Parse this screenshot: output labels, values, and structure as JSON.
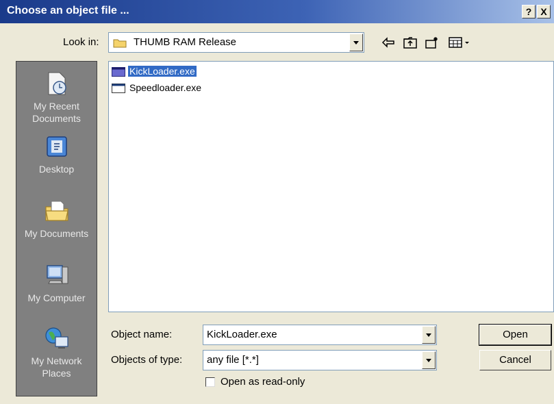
{
  "window": {
    "title": "Choose an object file ...",
    "help_label": "?",
    "close_label": "X"
  },
  "lookin": {
    "label": "Look in:",
    "value": "THUMB RAM Release"
  },
  "toolbar": {
    "icons": [
      "back-arrow-icon",
      "up-folder-icon",
      "new-folder-icon",
      "view-menu-icon"
    ]
  },
  "places": [
    {
      "label": "My Recent\nDocuments",
      "icon": "recent-documents-icon"
    },
    {
      "label": "Desktop",
      "icon": "desktop-icon"
    },
    {
      "label": "My Documents",
      "icon": "my-documents-icon"
    },
    {
      "label": "My Computer",
      "icon": "my-computer-icon"
    },
    {
      "label": "My Network\nPlaces",
      "icon": "network-places-icon"
    }
  ],
  "files": [
    {
      "name": "KickLoader.exe",
      "selected": true
    },
    {
      "name": "Speedloader.exe",
      "selected": false
    }
  ],
  "form": {
    "name_label": "Object name:",
    "name_value": "KickLoader.exe",
    "type_label": "Objects of type:",
    "type_value": "any file [*.*]",
    "readonly_label": "Open as read-only",
    "readonly_checked": false
  },
  "buttons": {
    "open": "Open",
    "cancel": "Cancel"
  },
  "colors": {
    "selection": "#316ac5",
    "places_bg": "#808080",
    "dialog_bg": "#ece9d8"
  }
}
